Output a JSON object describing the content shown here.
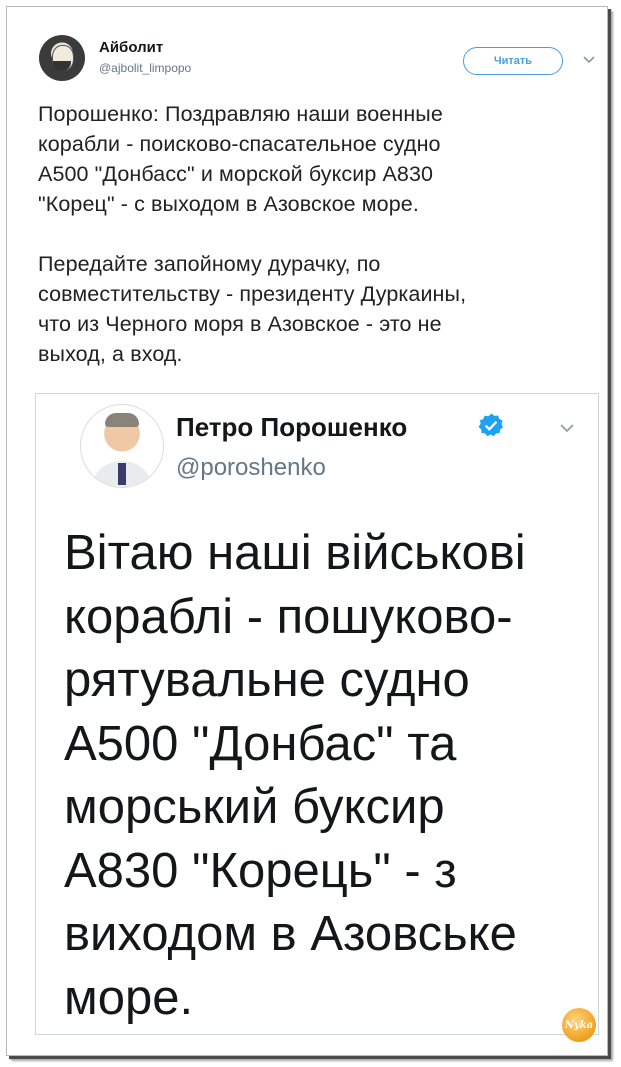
{
  "tweet": {
    "author_name": "Айболит",
    "author_handle": "@ajbolit_limpopo",
    "follow_label": "Читать",
    "paragraphs": [
      "Порошенко: Поздравляю наши военные\nкорабли - поисково-спасательное судно\nА500 \"Донбасс\" и морской буксир А830\n\"Корец\" - с выходом в Азовское море.",
      "Передайте запойному дурачку, по\nсовместительству - президенту Дуркаины,\nчто из Черного моря в Азовское - это не\nвыход, а вход."
    ]
  },
  "embedded_tweet": {
    "author_name": "Петро Порошенко",
    "author_handle": "@poroshenko",
    "text": "Вітаю наші військові\nкораблі - пошуково-\nрятувальне судно\nА500 \"Донбас\" та\nморський буксир\nА830 \"Корець\" - з\nвиходом в Азовське\nморе."
  },
  "watermark": "Nyka",
  "icons": {
    "menu": "chevron-down-icon",
    "verified": "verified-badge-icon"
  },
  "colors": {
    "accent": "#1da1f2",
    "text": "#14171a",
    "muted": "#657786"
  }
}
